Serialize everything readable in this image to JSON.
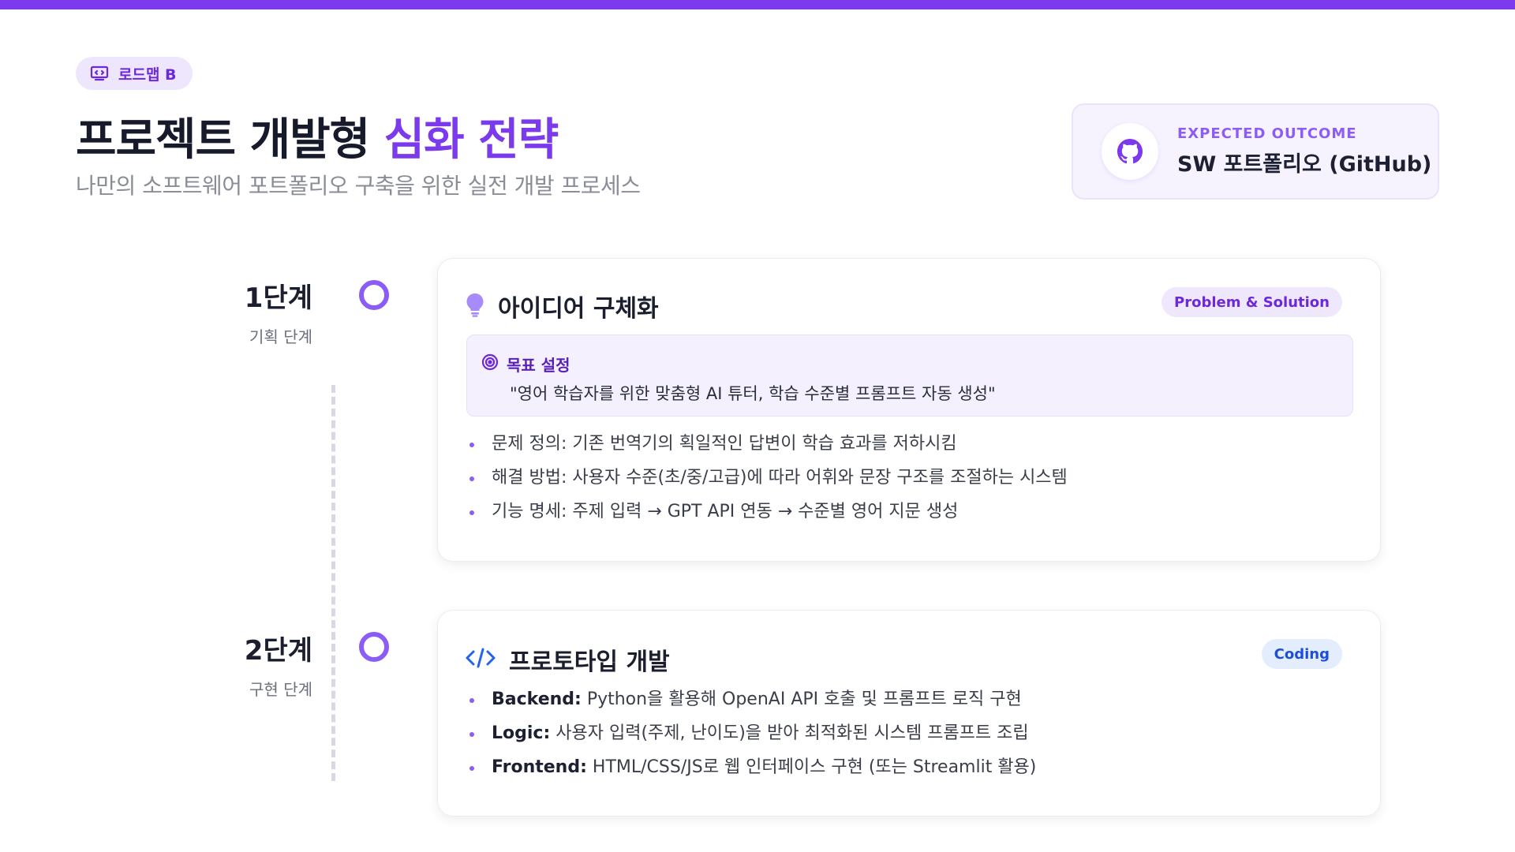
{
  "colors": {
    "accent": "#7c3aed",
    "accent_light": "#ede6fc",
    "code_blue": "#2563eb"
  },
  "badge": {
    "icon": "presentation-board-icon",
    "label": "로드맵 B"
  },
  "header": {
    "title_main": "프로젝트 개발형",
    "title_accent": "심화 전략",
    "subtitle": "나만의 소프트웨어 포트폴리오 구축을 위한 실전 개발 프로세스"
  },
  "outcome": {
    "icon": "github-icon",
    "eyebrow": "EXPECTED OUTCOME",
    "value": "SW 포트폴리오 (GitHub)"
  },
  "steps": [
    {
      "num": "1단계",
      "sub": "기획 단계",
      "icon": "lightbulb-icon",
      "title": "아이디어 구체화",
      "tag": "Problem & Solution",
      "goal": {
        "icon": "target-icon",
        "label": "목표 설정",
        "text": "\"영어 학습자를 위한 맞춤형 AI 튜터, 학습 수준별 프롬프트 자동 생성\""
      },
      "bullets": [
        "문제 정의: 기존 번역기의 획일적인 답변이 학습 효과를 저하시킴",
        "해결 방법: 사용자 수준(초/중/고급)에 따라 어휘와 문장 구조를 조절하는 시스템",
        "기능 명세: 주제 입력 → GPT API 연동 → 수준별 영어 지문 생성"
      ]
    },
    {
      "num": "2단계",
      "sub": "구현 단계",
      "icon": "code-icon",
      "title": "프로토타입 개발",
      "tag": "Coding",
      "bullets": [
        {
          "key": "Backend:",
          "text": " Python을 활용해 OpenAI API 호출 및 프롬프트 로직 구현"
        },
        {
          "key": "Logic:",
          "text": " 사용자 입력(주제, 난이도)을 받아 최적화된 시스템 프롬프트 조립"
        },
        {
          "key": "Frontend:",
          "text": " HTML/CSS/JS로 웹 인터페이스 구현 (또는 Streamlit 활용)"
        }
      ]
    }
  ]
}
